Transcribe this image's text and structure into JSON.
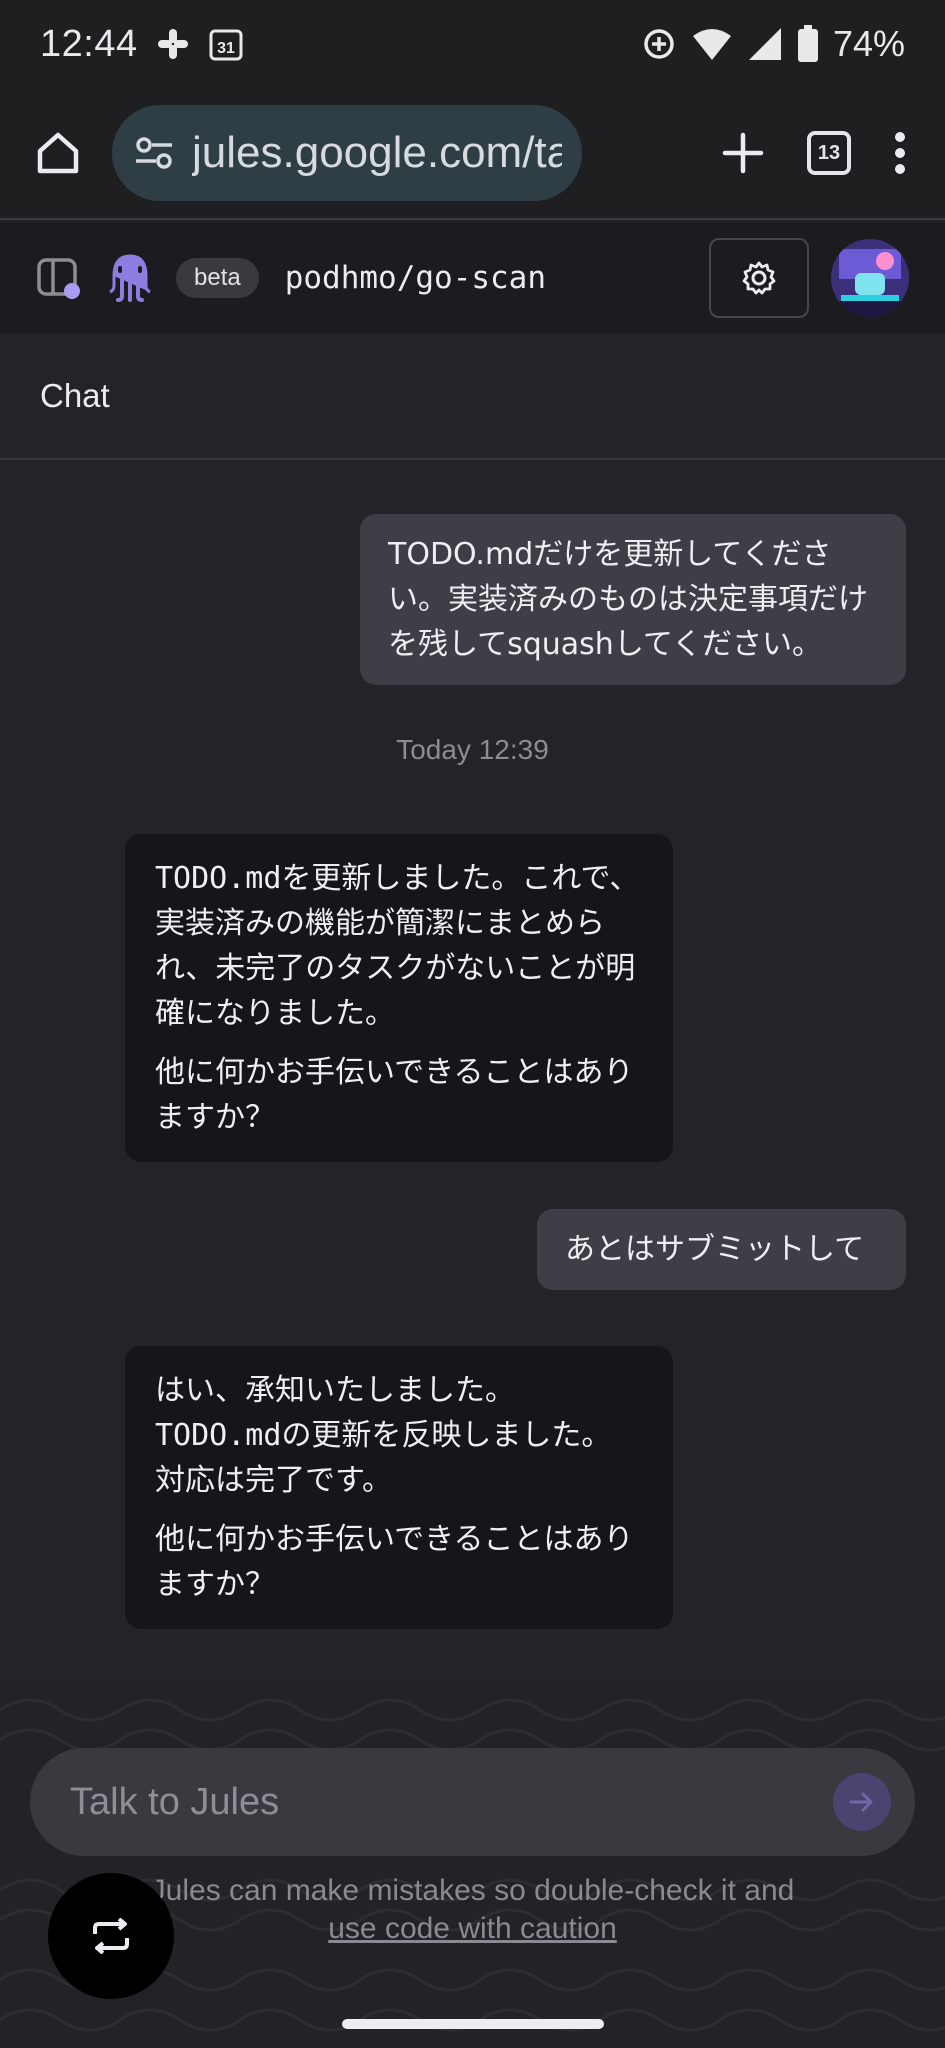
{
  "status_bar": {
    "time": "12:44",
    "calendar_day": "31",
    "battery_percent": "74%"
  },
  "browser": {
    "url": "jules.google.com/ta",
    "tab_count": "13"
  },
  "app_header": {
    "badge": "beta",
    "repo": "podhmo/go-scan"
  },
  "chat": {
    "title": "Chat",
    "timestamp": "Today 12:39",
    "messages": [
      {
        "role": "user",
        "text": "TODO.mdだけを更新してください。実装済みのものは決定事項だけを残してsquashしてください。"
      },
      {
        "role": "assistant",
        "code": "TODO.md",
        "p1_rest": "を更新しました。これで、実装済みの機能が簡潔にまとめられ、未完了のタスクがないことが明確になりました。",
        "p2": "他に何かお手伝いできることはありますか？"
      },
      {
        "role": "user",
        "text": "あとはサブミットして"
      },
      {
        "role": "assistant",
        "line1": "はい、承知いたしました。",
        "code": "TODO.md",
        "line2_rest": "の更新を反映しました。",
        "line3": "対応は完了です。",
        "p2": "他に何かお手伝いできることはありますか？"
      }
    ]
  },
  "composer": {
    "placeholder": "Talk to Jules"
  },
  "disclaimer": {
    "text": "Jules can make mistakes so double-check it and",
    "link": "use code with caution"
  }
}
